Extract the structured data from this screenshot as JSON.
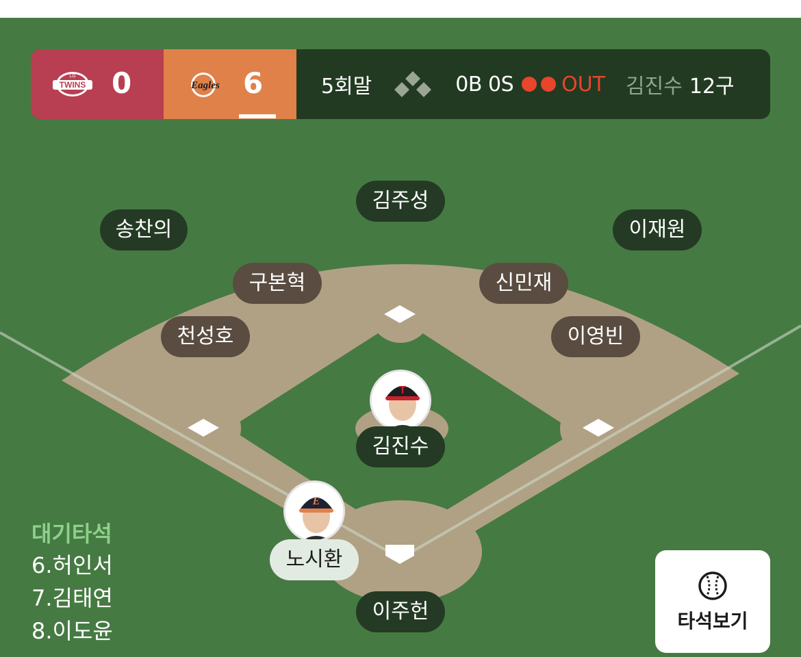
{
  "scoreboard": {
    "away": {
      "logo_text": "TWINS",
      "logo_sub": "LG",
      "score": "0",
      "color": "#b83f52"
    },
    "home": {
      "logo_text": "Eagles",
      "score": "6",
      "color": "#e0814a"
    },
    "inning": "5회말",
    "count": "0B 0S",
    "outs": 2,
    "out_label": "OUT",
    "pitcher": "김진수",
    "pitch_count": "12구"
  },
  "fielders": {
    "center": "김주성",
    "left": "송찬의",
    "right": "이재원",
    "shortstop": "구본혁",
    "second": "신민재",
    "third": "천성호",
    "first": "이영빈",
    "pitcher": "김진수",
    "catcher": "이주헌"
  },
  "batter": {
    "name": "노시환",
    "cap_letter": "E"
  },
  "pitcher_cap_letter": "T",
  "waiting": {
    "title": "대기타석",
    "items": [
      "6.허인서",
      "7.김태연",
      "8.이도윤"
    ]
  },
  "atbat_button": {
    "label": "타석보기",
    "icon": "baseball-icon"
  },
  "colors": {
    "grass": "#467a43",
    "dirt": "#b0a185",
    "out": "#e8452c"
  }
}
